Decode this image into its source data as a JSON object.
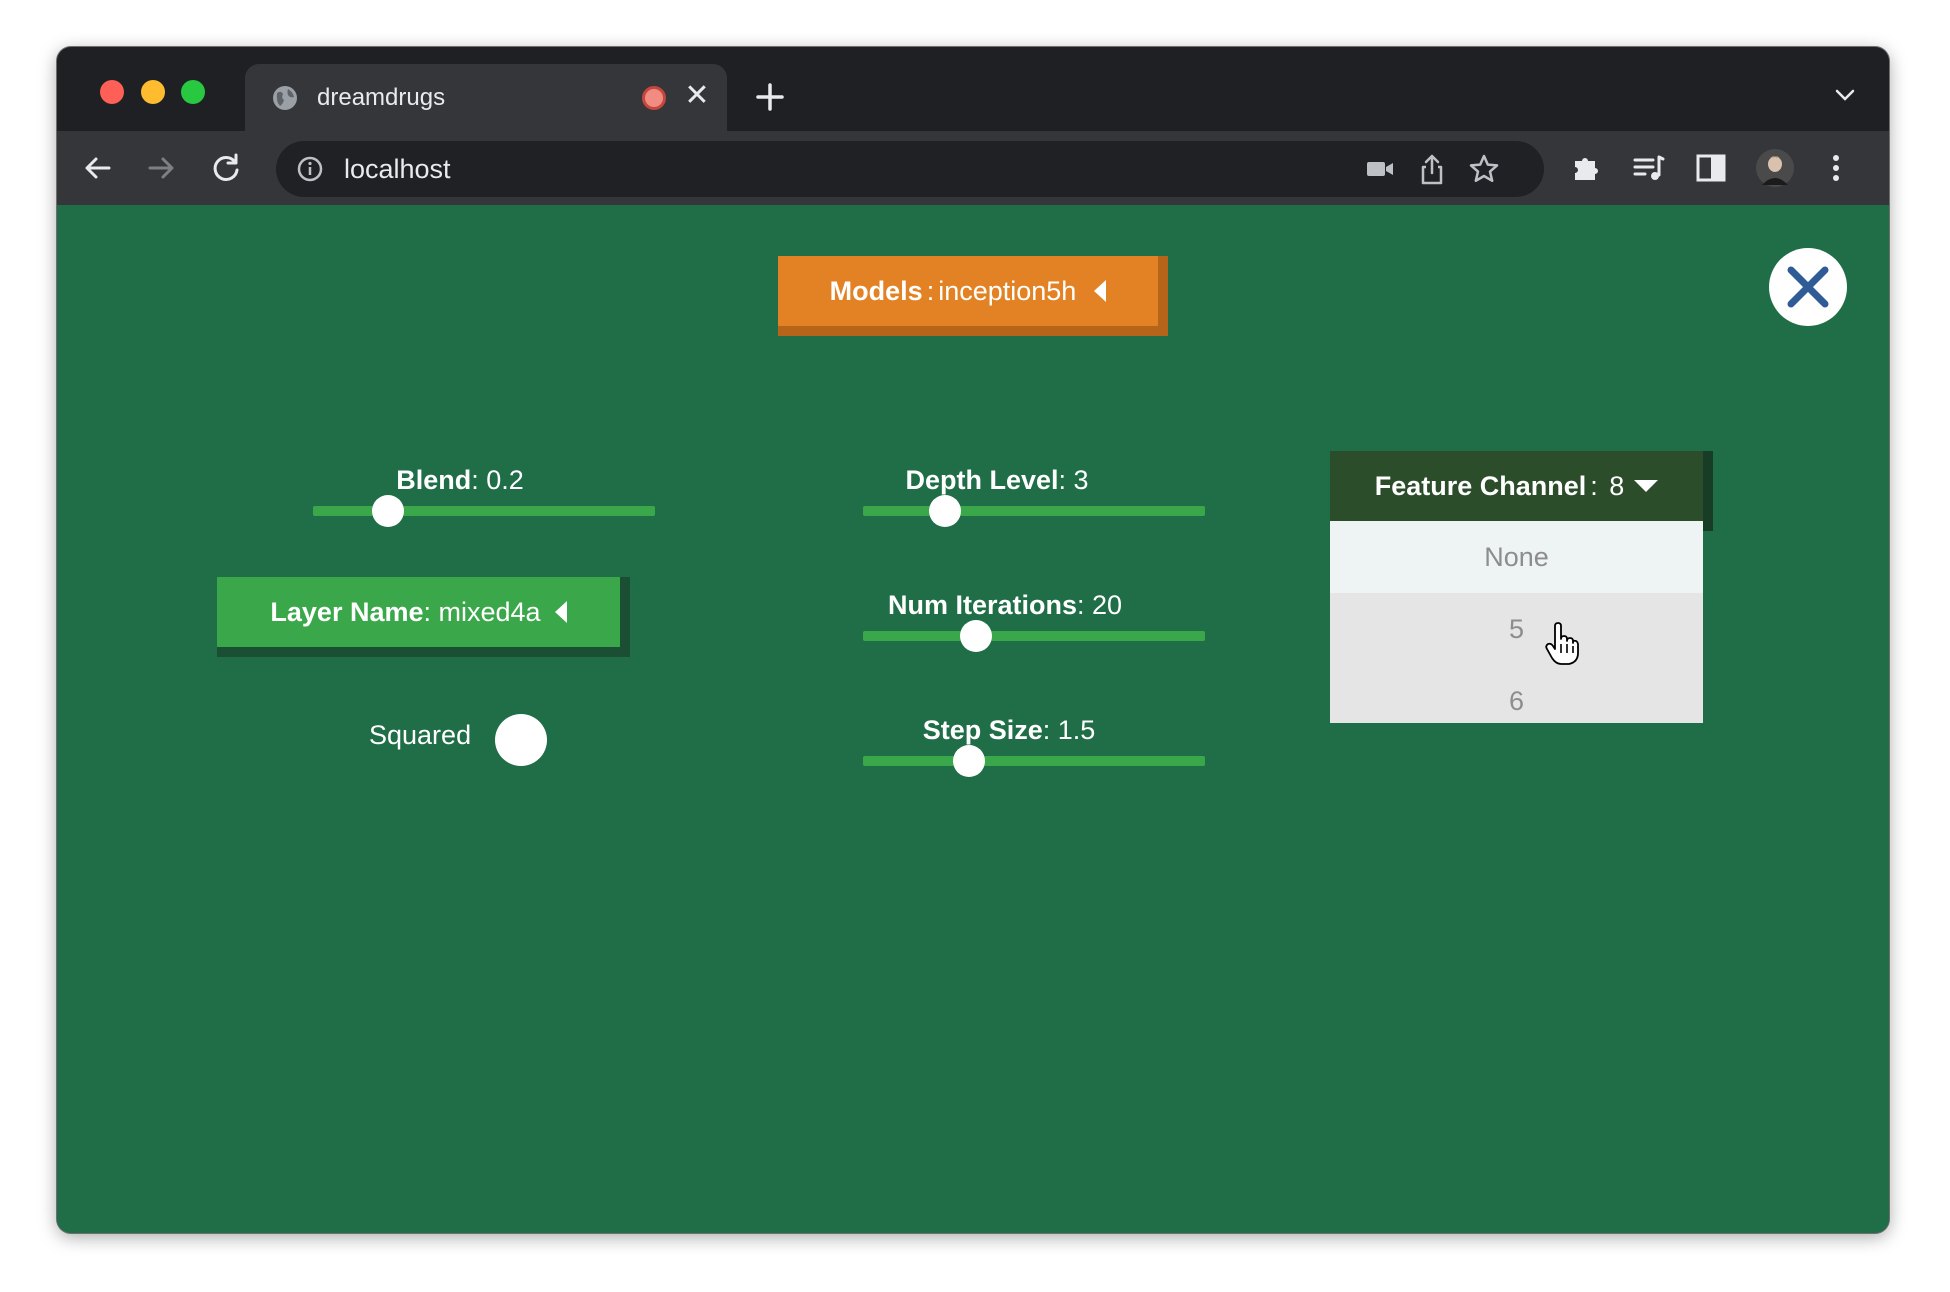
{
  "browser": {
    "tab_title": "dreamdrugs",
    "url": "localhost"
  },
  "app": {
    "models": {
      "label": "Models",
      "value": "inception5h"
    },
    "layer_name": {
      "label": "Layer Name",
      "value": "mixed4a"
    },
    "squared": {
      "label": "Squared",
      "checked": false
    },
    "sliders": [
      {
        "label": "Blend",
        "value": "0.2",
        "fraction": 0.22
      },
      {
        "label": "Depth Level",
        "value": "3",
        "fraction": 0.24
      },
      {
        "label": "Num Iterations",
        "value": "20",
        "fraction": 0.33
      },
      {
        "label": "Step Size",
        "value": "1.5",
        "fraction": 0.31
      }
    ],
    "feature_channel": {
      "label": "Feature Channel",
      "value": "8",
      "options": [
        "None",
        "5",
        "6"
      ],
      "hovered_option": "None"
    }
  },
  "colors": {
    "background": "#1f6e47",
    "models_button": "#e38224",
    "layer_button": "#3aa84a",
    "feature_channel_button": "#2c4d2a",
    "slider_track": "#3aa84a",
    "close_x": "#2f5b97"
  },
  "icons": [
    "globe-icon",
    "recording-icon",
    "tab-close-icon",
    "new-tab-icon",
    "tab-search-icon",
    "back-icon",
    "forward-icon",
    "reload-icon",
    "site-info-icon",
    "camera-icon",
    "share-icon",
    "bookmark-star-icon",
    "extensions-icon",
    "reading-list-icon",
    "side-panel-icon",
    "profile-avatar",
    "kebab-menu-icon",
    "close-x-icon",
    "hand-cursor-icon"
  ]
}
